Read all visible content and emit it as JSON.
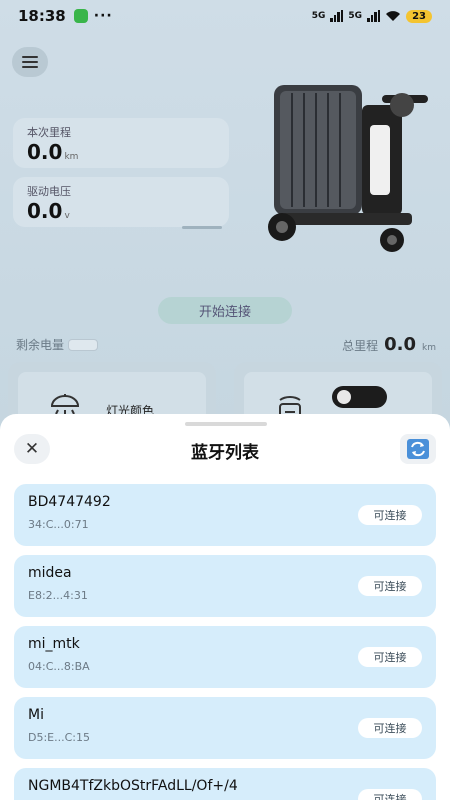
{
  "statusbar": {
    "time": "18:38",
    "dots": "···",
    "sig1": "5G",
    "sig2": "5G",
    "battery": "23"
  },
  "dashboard": {
    "trip_label": "本次里程",
    "trip_value": "0.0",
    "trip_unit": "km",
    "voltage_label": "驱动电压",
    "voltage_value": "0.0",
    "voltage_unit": "v",
    "connect_label": "开始连接",
    "remain_label": "剩余电量",
    "total_label": "总里程",
    "total_value": "0.0",
    "total_unit": "km",
    "lamp_label": "灯光颜色"
  },
  "sheet": {
    "title": "蓝牙列表",
    "close_icon": "close-icon",
    "refresh_icon": "refresh-icon"
  },
  "devices": [
    {
      "name": "BD4747492",
      "mac": "34:C...0:71",
      "status": "可连接"
    },
    {
      "name": "midea",
      "mac": "E8:2...4:31",
      "status": "可连接"
    },
    {
      "name": "mi_mtk",
      "mac": "04:C...8:BA",
      "status": "可连接"
    },
    {
      "name": "Mi",
      "mac": "D5:E...C:15",
      "status": "可连接"
    },
    {
      "name": "NGMB4TfZkbOStrFAdLL/Of+/4",
      "mac": "",
      "status": "可连接"
    }
  ],
  "colors": {
    "accent": "#d6edfb",
    "toggle": "#1c1c1c",
    "battery_badge": "#f4c430"
  }
}
